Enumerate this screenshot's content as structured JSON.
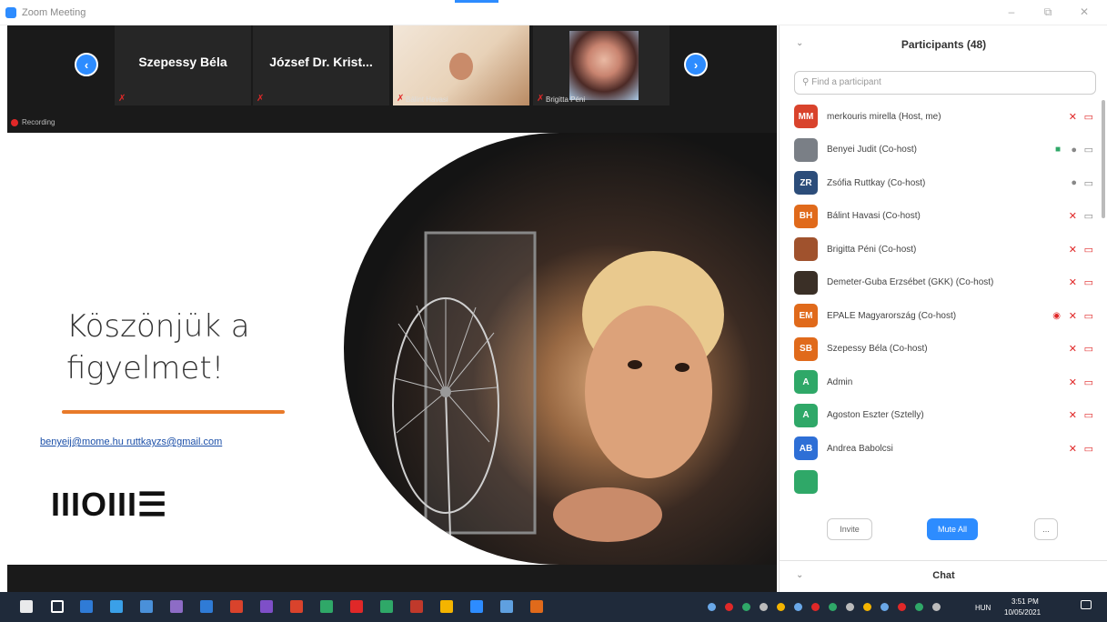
{
  "window": {
    "title": "Zoom Meeting",
    "minimize": "–",
    "restore": "⧉",
    "close": "✕"
  },
  "video_strip": {
    "prev_icon": "chevron-left-icon",
    "next_icon": "chevron-right-icon",
    "tiles": [
      {
        "name": "Szepessy Béla",
        "label": ""
      },
      {
        "name": "József Dr. Krist...",
        "label": ""
      },
      {
        "name": "",
        "label": "Bálint Havasi"
      },
      {
        "name": "",
        "label": "Brigitta Péni"
      }
    ],
    "recording": "Recording"
  },
  "slide": {
    "title_line1": "Köszönjük a",
    "title_line2": "figyelmet!",
    "link1": "benyeij@mome.hu",
    "link2": "ruttkayzs@gmail.com",
    "logo": "IIIOIII☰"
  },
  "participants": {
    "title": "Participants (48)",
    "search_placeholder": "Find a participant",
    "list": [
      {
        "initials": "MM",
        "color": "#d9432c",
        "name": "merkouris mirella (Host, me)",
        "mic": "muted",
        "cam": "off",
        "extra": ""
      },
      {
        "initials": "",
        "color": "#7a7f86",
        "name": "Benyei Judit (Co-host)",
        "mic": "on",
        "cam": "on",
        "extra": "share"
      },
      {
        "initials": "ZR",
        "color": "#2c4d7a",
        "name": "Zsófia Ruttkay (Co-host)",
        "mic": "on",
        "cam": "on",
        "extra": ""
      },
      {
        "initials": "BH",
        "color": "#e06a1b",
        "name": "Bálint Havasi (Co-host)",
        "mic": "muted",
        "cam": "on",
        "extra": ""
      },
      {
        "initials": "",
        "color": "#a0522d",
        "name": "Brigitta Péni (Co-host)",
        "mic": "muted",
        "cam": "off",
        "extra": ""
      },
      {
        "initials": "",
        "color": "#3a2f26",
        "name": "Demeter-Guba Erzsébet (GKK) (Co-host)",
        "mic": "muted",
        "cam": "off",
        "extra": ""
      },
      {
        "initials": "EM",
        "color": "#e06a1b",
        "name": "EPALE Magyarország (Co-host)",
        "mic": "muted",
        "cam": "off",
        "extra": "rec"
      },
      {
        "initials": "SB",
        "color": "#e06a1b",
        "name": "Szepessy Béla (Co-host)",
        "mic": "muted",
        "cam": "off",
        "extra": ""
      },
      {
        "initials": "A",
        "color": "#2fa868",
        "name": "Admin",
        "mic": "muted",
        "cam": "off",
        "extra": ""
      },
      {
        "initials": "A",
        "color": "#2fa868",
        "name": "Agoston Eszter (Sztelly)",
        "mic": "muted",
        "cam": "off",
        "extra": ""
      },
      {
        "initials": "AB",
        "color": "#2e6fd6",
        "name": "Andrea Babolcsi",
        "mic": "muted",
        "cam": "off",
        "extra": ""
      },
      {
        "initials": "",
        "color": "#2fa868",
        "name": "",
        "mic": "muted",
        "cam": "off",
        "extra": ""
      }
    ],
    "invite": "Invite",
    "mute_all": "Mute All",
    "more": "..."
  },
  "chat": {
    "title": "Chat"
  },
  "taskbar": {
    "language": "HUN",
    "time": "3:51 PM",
    "date": "10/05/2021",
    "app_colors": [
      "#2f7bd6",
      "#3aa0e8",
      "#4a90d9",
      "#8d6cc6",
      "#2f7bd6",
      "#d9432c",
      "#7e4fc8",
      "#d9432c",
      "#2fa868",
      "#e02828",
      "#2fa868",
      "#c0392b",
      "#f4b400",
      "#2d8cff",
      "#5fa0e0",
      "#e06a1b"
    ]
  },
  "colors": {
    "accent": "#2d8cff",
    "muted_red": "#e02828",
    "slide_orange": "#e87a2a"
  }
}
